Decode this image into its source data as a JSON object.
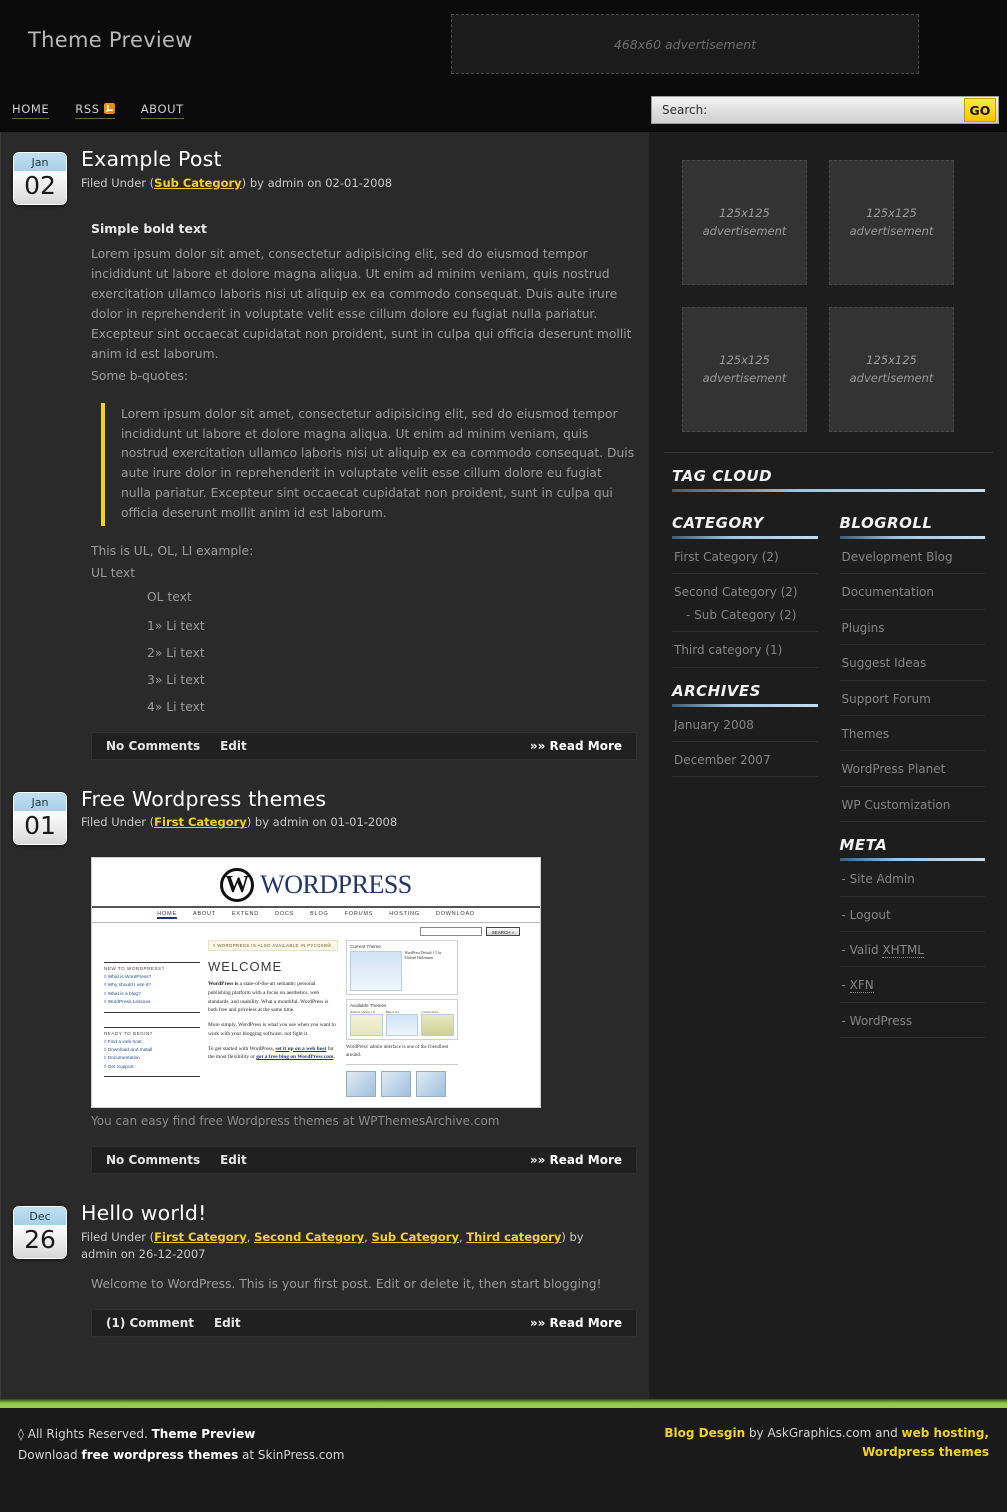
{
  "header": {
    "site_title": "Theme Preview",
    "ad_banner_label": "468x60 advertisement"
  },
  "nav": {
    "items": [
      {
        "label": "HOME",
        "icon": ""
      },
      {
        "label": "RSS",
        "icon": "rss-icon"
      },
      {
        "label": "ABOUT",
        "icon": ""
      }
    ],
    "search": {
      "value": "Search:",
      "placeholder": "Search:",
      "button_label": "GO"
    }
  },
  "posts": [
    {
      "date": {
        "month": "Jan",
        "day": "02"
      },
      "title": "Example Post",
      "meta_prefix": "Filed Under (",
      "categories": [
        "Sub Category"
      ],
      "meta_suffix": ") by admin on 02-01-2008",
      "lead": "Simple bold text",
      "paragraph": "Lorem ipsum dolor sit amet, consectetur adipisicing elit, sed do eiusmod tempor incididunt ut labore et dolore magna aliqua. Ut enim ad minim veniam, quis nostrud exercitation ullamco laboris nisi ut aliquip ex ea commodo consequat. Duis aute irure dolor in reprehenderit in voluptate velit esse cillum dolore eu fugiat nulla pariatur. Excepteur sint occaecat cupidatat non proident, sunt in culpa qui officia deserunt mollit anim id est laborum.",
      "bquote_intro": "Some b-quotes:",
      "blockquote": "Lorem ipsum dolor sit amet, consectetur adipisicing elit, sed do eiusmod tempor incididunt ut labore et dolore magna aliqua. Ut enim ad minim veniam, quis nostrud exercitation ullamco laboris nisi ut aliquip ex ea commodo consequat. Duis aute irure dolor in reprehenderit in voluptate velit esse cillum dolore eu fugiat nulla pariatur. Excepteur sint occaecat cupidatat non proident, sunt in culpa qui officia deserunt mollit anim id est laborum.",
      "list_intro": "This is UL, OL, LI example:",
      "ul_text": "UL text",
      "ol_text": "OL text",
      "li_items": [
        "1» Li text",
        "2» Li text",
        "3» Li text",
        "4» Li text"
      ],
      "footer": {
        "comments": "No Comments",
        "edit": "Edit",
        "readmore": "»» Read More"
      }
    },
    {
      "date": {
        "month": "Jan",
        "day": "01"
      },
      "title": "Free Wordpress themes",
      "meta_prefix": "Filed Under (",
      "categories": [
        "First Category"
      ],
      "meta_suffix": ") by admin on 01-01-2008",
      "caption": "You can easy find free Wordpress themes at WPThemesArchive.com",
      "footer": {
        "comments": "No Comments",
        "edit": "Edit",
        "readmore": "»» Read More"
      }
    },
    {
      "date": {
        "month": "Dec",
        "day": "26"
      },
      "title": "Hello world!",
      "meta_prefix": "Filed Under (",
      "categories": [
        "First Category",
        "Second Category",
        "Sub Category",
        "Third category"
      ],
      "meta_suffix": ") by admin on 26-12-2007",
      "body": "Welcome to WordPress. This is your first post. Edit or delete it, then start blogging!",
      "footer": {
        "comments": "(1) Comment",
        "edit": "Edit",
        "readmore": "»» Read More"
      }
    }
  ],
  "wp_screenshot": {
    "wordmark": "WORDPRESS",
    "logo_letter": "W",
    "nav": [
      "HOME",
      "ABOUT",
      "EXTEND",
      "DOCS",
      "BLOG",
      "FORUMS",
      "HOSTING",
      "DOWNLOAD"
    ],
    "search_button": "SEARCH »",
    "banner": "◊ WORDPRESS IS ALSO AVAILABLE IN РУССКИЙ.",
    "welcome": "WELCOME",
    "p1_bold": "WordPress is",
    "p1": " a state-of-the-art semantic personal publishing platform with a focus on aesthetics, web standards, and usability. What a mouthful. WordPress is both free and priceless at the same time.",
    "p2": "More simply, WordPress is what you use when you want to work with your blogging software, not fight it.",
    "p3_a": "To get started with WordPress, ",
    "p3_link1": "set it up on a web host",
    "p3_b": " for the most flexibility or ",
    "p3_link2": "got a free blog on WordPress.com",
    "p3_c": ".",
    "left_sections": [
      {
        "title": "NEW TO WORDPRESS?",
        "links": [
          "◊ What is WordPress?",
          "◊ Why should I use it?",
          "◊ What is a blog?",
          "◊ WordPress Lessons"
        ]
      },
      {
        "title": "READY TO BEGIN?",
        "links": [
          "◊ Find a web host",
          "◊ Download and Install",
          "◊ Documentation",
          "◊ Get Support"
        ]
      }
    ],
    "card1_title": "Current Theme",
    "card1_note": "WordPress Default 1.5 by Michael Heilemann",
    "card2_title": "Available Themes",
    "themes": [
      "Almost Spring 1.0",
      "Blix 0.9.3",
      "Connections"
    ],
    "shot_caption": "WordPress' admin interface is one of the friendliest around."
  },
  "sidebar": {
    "ads": [
      {
        "line1": "125x125",
        "line2": "advertisement"
      },
      {
        "line1": "125x125",
        "line2": "advertisement"
      },
      {
        "line1": "125x125",
        "line2": "advertisement"
      },
      {
        "line1": "125x125",
        "line2": "advertisement"
      }
    ],
    "tag_cloud_title": "TAG CLOUD",
    "category": {
      "title": "CATEGORY",
      "items": [
        {
          "label": "First Category (2)",
          "sub": null
        },
        {
          "label": "Second Category (2)",
          "sub": "- Sub Category (2)"
        },
        {
          "label": "Third category (1)",
          "sub": null
        }
      ]
    },
    "archives": {
      "title": "ARCHIVES",
      "items": [
        "January 2008",
        "December 2007"
      ]
    },
    "blogroll": {
      "title": "BLOGROLL",
      "items": [
        "Development Blog",
        "Documentation",
        "Plugins",
        "Suggest Ideas",
        "Support Forum",
        "Themes",
        "WordPress Planet",
        "WP Customization"
      ]
    },
    "meta": {
      "title": "META",
      "items": [
        {
          "prefix": "- ",
          "label": "Site Admin",
          "dotted": false
        },
        {
          "prefix": "- ",
          "label": "Logout",
          "dotted": false
        },
        {
          "prefix": "- Valid ",
          "label": "XHTML",
          "dotted": true
        },
        {
          "prefix": "- ",
          "label": "XFN",
          "dotted": true
        },
        {
          "prefix": "- ",
          "label": "WordPress",
          "dotted": false
        }
      ]
    }
  },
  "footer": {
    "left_line1_pre": "◊ All Rights Reserved. ",
    "left_line1_bold": "Theme Preview",
    "left_line2_pre": "Download ",
    "left_line2_bold": "free wordpress themes",
    "left_line2_post": " at SkinPress.com",
    "right_bold1": "Blog Desgin",
    "right_mid": " by AskGraphics.com and ",
    "right_bold2": "web hosting, Wordpress themes"
  },
  "colors": {
    "accent_yellow": "#f2d024",
    "accent_green": "#9ccb57",
    "heading_rule": "#9fc4e0",
    "quote_bar": "#f3d31a"
  }
}
